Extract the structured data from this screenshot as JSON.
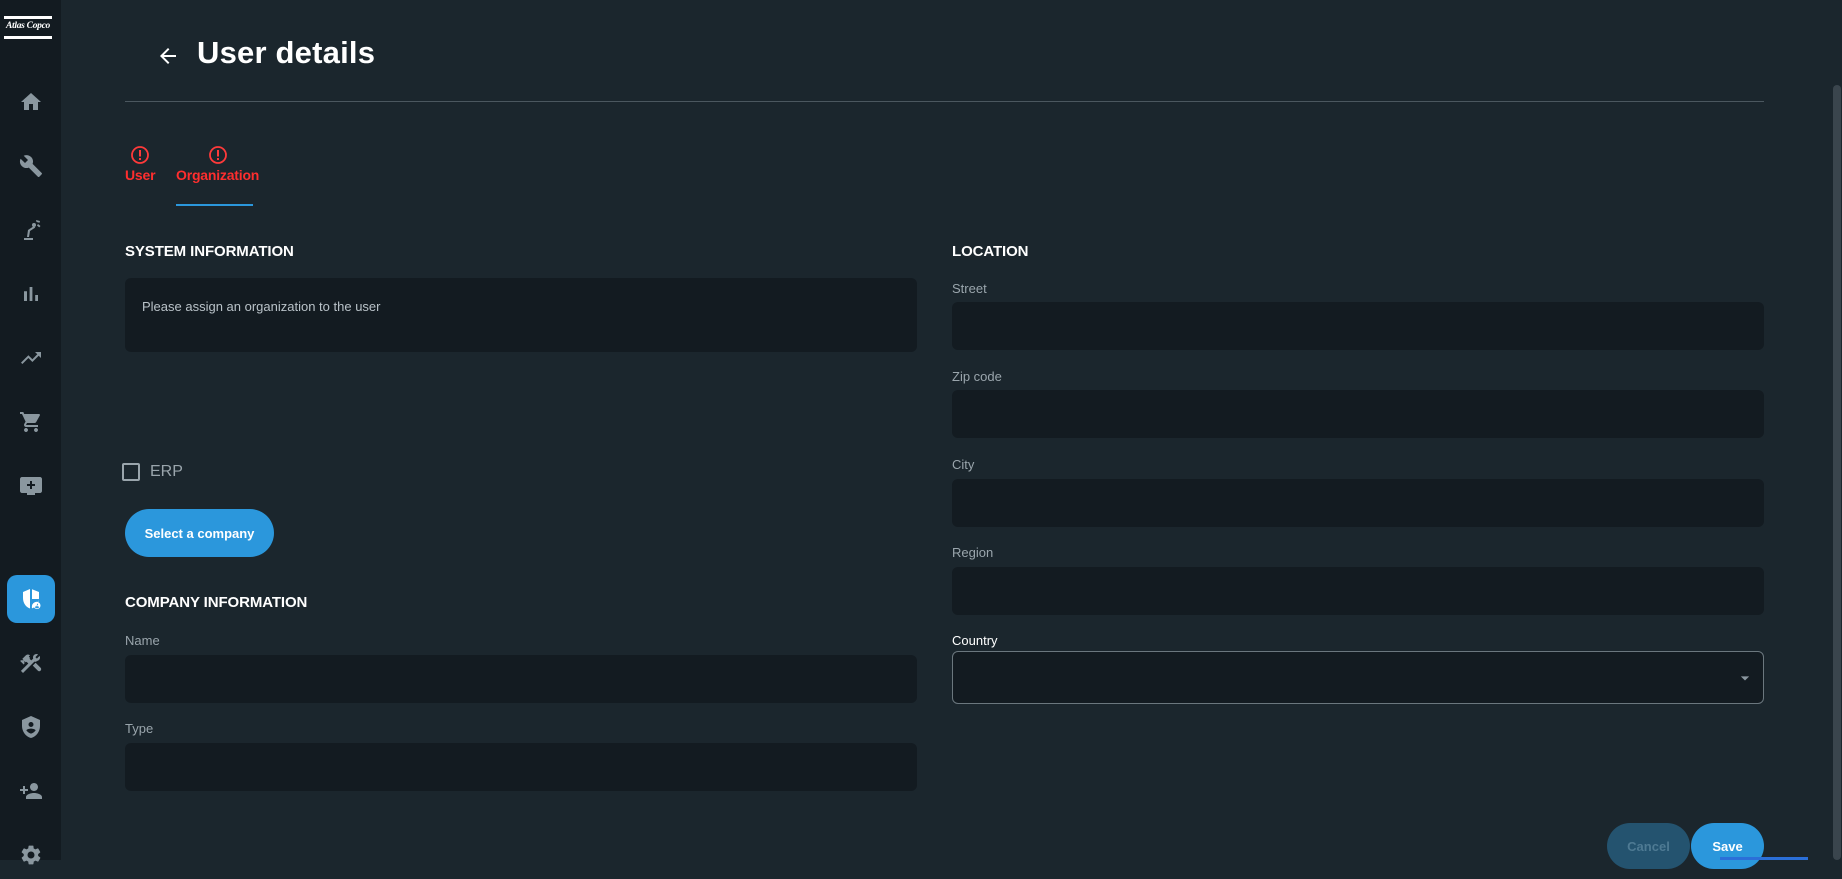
{
  "brand": {
    "logo_text": "Atlas Copco"
  },
  "sidebar": {
    "items": [
      {
        "name": "home",
        "icon": "home-icon"
      },
      {
        "name": "service",
        "icon": "wrench-icon"
      },
      {
        "name": "robot",
        "icon": "robot-arm-icon"
      },
      {
        "name": "reports",
        "icon": "bar-chart-icon"
      },
      {
        "name": "trends",
        "icon": "trending-up-icon"
      },
      {
        "name": "shop",
        "icon": "cart-icon"
      },
      {
        "name": "messages",
        "icon": "monitor-add-icon"
      },
      {
        "name": "user-admin",
        "icon": "shield-user-icon",
        "active": true
      },
      {
        "name": "tools",
        "icon": "hammer-screwdriver-icon"
      },
      {
        "name": "security",
        "icon": "shield-icon"
      },
      {
        "name": "add-user",
        "icon": "person-add-icon"
      },
      {
        "name": "settings",
        "icon": "gear-icon"
      }
    ]
  },
  "header": {
    "title": "User details"
  },
  "tabs": [
    {
      "label": "User",
      "status": "error"
    },
    {
      "label": "Organization",
      "status": "error",
      "active": true
    }
  ],
  "system_information": {
    "title": "SYSTEM INFORMATION",
    "message": "Please assign an organization to  the user",
    "erp_label": "ERP",
    "erp_checked": false,
    "select_company_label": "Select a company"
  },
  "company_information": {
    "title": "COMPANY INFORMATION",
    "name_label": "Name",
    "name_value": "",
    "type_label": "Type",
    "type_value": ""
  },
  "location": {
    "title": "LOCATION",
    "street_label": "Street",
    "street_value": "",
    "zip_label": "Zip code",
    "zip_value": "",
    "city_label": "City",
    "city_value": "",
    "region_label": "Region",
    "region_value": "",
    "country_label": "Country",
    "country_value": ""
  },
  "actions": {
    "cancel_label": "Cancel",
    "save_label": "Save"
  },
  "colors": {
    "background": "#1b262d",
    "sidebar": "#131b21",
    "accent": "#2b97dc",
    "error": "#ff2e2e"
  }
}
